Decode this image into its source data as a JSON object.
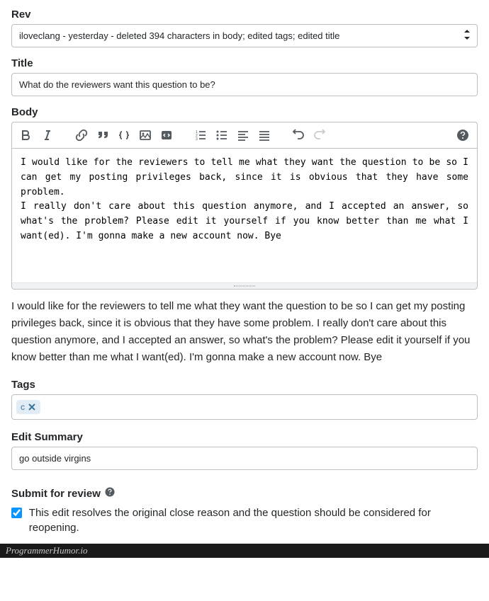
{
  "rev": {
    "label": "Rev",
    "selected": "iloveclang - yesterday - deleted 394 characters in body; edited tags; edited title"
  },
  "title": {
    "label": "Title",
    "value": "What do the reviewers want this question to be?"
  },
  "body": {
    "label": "Body",
    "value": "I would like for the reviewers to tell me what they want the question to be so I can get my posting privileges back, since it is obvious that they have some problem.\nI really don't care about this question anymore, and I accepted an answer, so what's the problem? Please edit it yourself if you know better than me what I want(ed). I'm gonna make a new account now. Bye"
  },
  "preview": "I would like for the reviewers to tell me what they want the question to be so I can get my posting privileges back, since it is obvious that they have some problem. I really don't care about this question anymore, and I accepted an answer, so what's the problem? Please edit it yourself if you know better than me what I want(ed). I'm gonna make a new account now. Bye",
  "tags": {
    "label": "Tags",
    "items": [
      "c"
    ]
  },
  "edit_summary": {
    "label": "Edit Summary",
    "value": "go outside virgins"
  },
  "submit": {
    "label": "Submit for review",
    "checkbox_checked": true,
    "checkbox_label": "This edit resolves the original close reason and the question should be considered for reopening."
  },
  "footer": "ProgrammerHumor.io"
}
